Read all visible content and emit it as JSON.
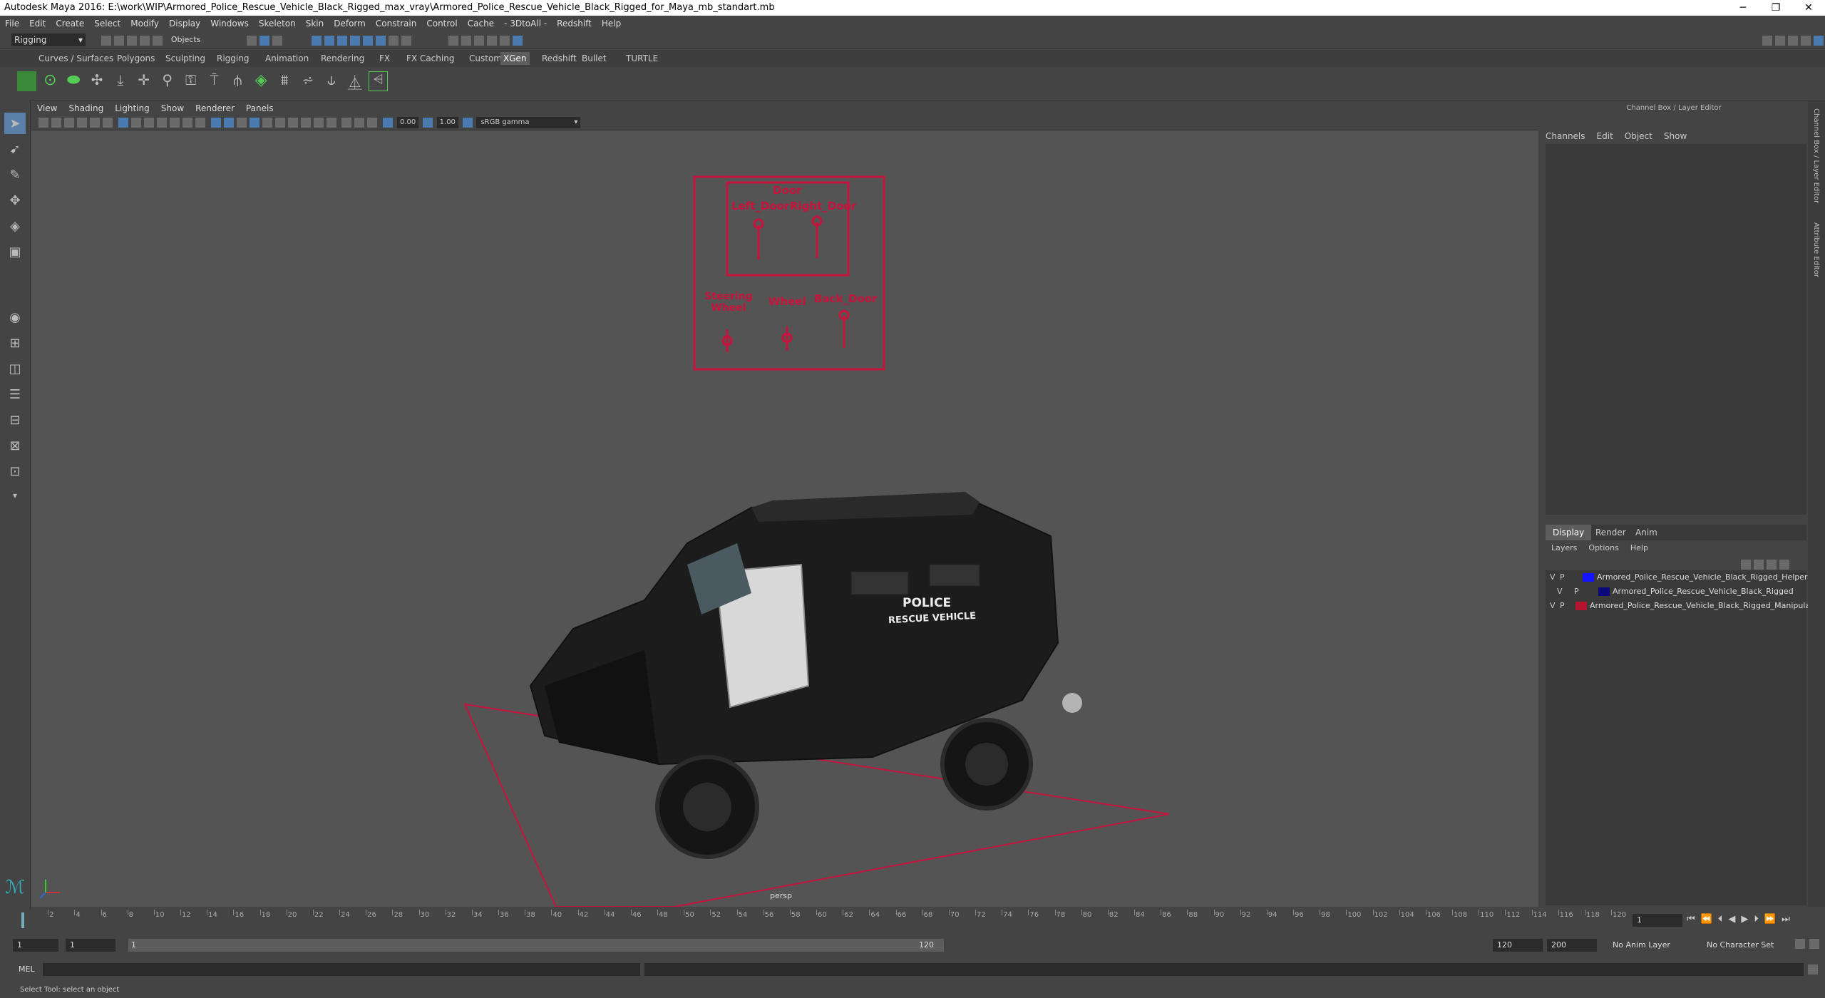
{
  "window": {
    "title": "Autodesk Maya 2016: E:\\work\\WIP\\Armored_Police_Rescue_Vehicle_Black_Rigged_max_vray\\Armored_Police_Rescue_Vehicle_Black_Rigged_for_Maya_mb_standart.mb",
    "minimize": "─",
    "maximize": "❐",
    "close": "✕"
  },
  "menubar": [
    "File",
    "Edit",
    "Create",
    "Select",
    "Modify",
    "Display",
    "Windows",
    "Skeleton",
    "Skin",
    "Deform",
    "Constrain",
    "Control",
    "Cache",
    "- 3DtoAll -",
    "Redshift",
    "Help"
  ],
  "statusline": {
    "mode": "Rigging",
    "selection_mode": "Objects"
  },
  "shelf_tabs": [
    "Curves / Surfaces",
    "Polygons",
    "Sculpting",
    "Rigging",
    "Animation",
    "Rendering",
    "FX",
    "FX Caching",
    "Custom",
    "XGen",
    "Redshift",
    "Bullet",
    "TURTLE"
  ],
  "shelf_active": "XGen",
  "viewport": {
    "menu": [
      "View",
      "Shading",
      "Lighting",
      "Show",
      "Renderer",
      "Panels"
    ],
    "exposure": "0.00",
    "gamma": "1.00",
    "color_space": "sRGB gamma",
    "camera_label": "persp",
    "rig_labels": {
      "door": "Door",
      "left_door": "Left_Door",
      "right_door": "Right_Door",
      "steering_wheel": "Steering\nWheel",
      "wheel": "Wheel",
      "back_door": "Back_Door"
    },
    "vehicle_text": {
      "police": "POLICE",
      "rescue": "RESCUE VEHICLE"
    },
    "rig_color": "#c8143c"
  },
  "channel_box": {
    "title": "Channel Box / Layer Editor",
    "menu": [
      "Channels",
      "Edit",
      "Object",
      "Show"
    ]
  },
  "layer_editor": {
    "tabs": [
      "Display",
      "Render",
      "Anim"
    ],
    "menu": [
      "Layers",
      "Options",
      "Help"
    ],
    "layers": [
      {
        "v": "V",
        "p": "P",
        "color": "#1414ff",
        "name": "Armored_Police_Rescue_Vehicle_Black_Rigged_Helpers"
      },
      {
        "v": "V",
        "p": "P",
        "color": "#0a0a7a",
        "name": "Armored_Police_Rescue_Vehicle_Black_Rigged"
      },
      {
        "v": "V",
        "p": "P",
        "color": "#b4142d",
        "name": "Armored_Police_Rescue_Vehicle_Black_Rigged_Manipula"
      }
    ]
  },
  "side_tabs": {
    "channel_box": "Channel Box / Layer Editor",
    "attribute_editor": "Attribute Editor"
  },
  "timeline": {
    "ticks": [
      "2",
      "4",
      "6",
      "8",
      "10",
      "12",
      "14",
      "16",
      "18",
      "20",
      "22",
      "24",
      "26",
      "28",
      "30",
      "32",
      "34",
      "36",
      "38",
      "40",
      "42",
      "44",
      "46",
      "48",
      "50",
      "52",
      "54",
      "56",
      "58",
      "60",
      "62",
      "64",
      "66",
      "68",
      "70",
      "72",
      "74",
      "76",
      "78",
      "80",
      "82",
      "84",
      "86",
      "88",
      "90",
      "92",
      "94",
      "96",
      "98",
      "100",
      "102",
      "104",
      "106",
      "108",
      "110",
      "112",
      "114",
      "116",
      "118",
      "120"
    ],
    "current_frame": "1"
  },
  "range": {
    "start": "1",
    "playback_start": "1",
    "slider_start": "1",
    "slider_end": "120",
    "playback_end": "120",
    "end": "200",
    "anim_layer": "No Anim Layer",
    "character_set": "No Character Set"
  },
  "command_line": {
    "label": "MEL"
  },
  "help_line": "Select Tool: select an object"
}
